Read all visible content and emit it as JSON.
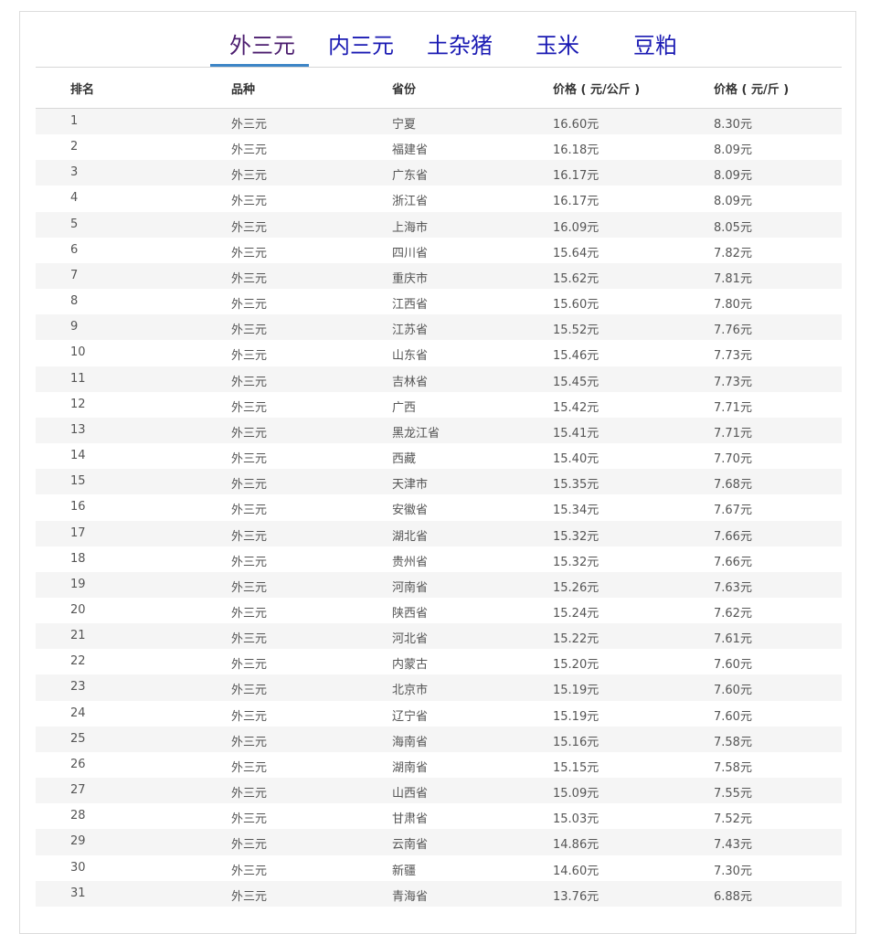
{
  "tabs": [
    {
      "label": "外三元",
      "active": true
    },
    {
      "label": "内三元",
      "active": false
    },
    {
      "label": "土杂猪",
      "active": false
    },
    {
      "label": "玉米",
      "active": false
    },
    {
      "label": "豆粕",
      "active": false
    }
  ],
  "table": {
    "headers": [
      "排名",
      "品种",
      "省份",
      "价格 ( 元/公斤 )",
      "价格 ( 元/斤 )"
    ],
    "rows": [
      [
        "1",
        "外三元",
        "宁夏",
        "16.60元",
        "8.30元"
      ],
      [
        "2",
        "外三元",
        "福建省",
        "16.18元",
        "8.09元"
      ],
      [
        "3",
        "外三元",
        "广东省",
        "16.17元",
        "8.09元"
      ],
      [
        "4",
        "外三元",
        "浙江省",
        "16.17元",
        "8.09元"
      ],
      [
        "5",
        "外三元",
        "上海市",
        "16.09元",
        "8.05元"
      ],
      [
        "6",
        "外三元",
        "四川省",
        "15.64元",
        "7.82元"
      ],
      [
        "7",
        "外三元",
        "重庆市",
        "15.62元",
        "7.81元"
      ],
      [
        "8",
        "外三元",
        "江西省",
        "15.60元",
        "7.80元"
      ],
      [
        "9",
        "外三元",
        "江苏省",
        "15.52元",
        "7.76元"
      ],
      [
        "10",
        "外三元",
        "山东省",
        "15.46元",
        "7.73元"
      ],
      [
        "11",
        "外三元",
        "吉林省",
        "15.45元",
        "7.73元"
      ],
      [
        "12",
        "外三元",
        "广西",
        "15.42元",
        "7.71元"
      ],
      [
        "13",
        "外三元",
        "黑龙江省",
        "15.41元",
        "7.71元"
      ],
      [
        "14",
        "外三元",
        "西藏",
        "15.40元",
        "7.70元"
      ],
      [
        "15",
        "外三元",
        "天津市",
        "15.35元",
        "7.68元"
      ],
      [
        "16",
        "外三元",
        "安徽省",
        "15.34元",
        "7.67元"
      ],
      [
        "17",
        "外三元",
        "湖北省",
        "15.32元",
        "7.66元"
      ],
      [
        "18",
        "外三元",
        "贵州省",
        "15.32元",
        "7.66元"
      ],
      [
        "19",
        "外三元",
        "河南省",
        "15.26元",
        "7.63元"
      ],
      [
        "20",
        "外三元",
        "陕西省",
        "15.24元",
        "7.62元"
      ],
      [
        "21",
        "外三元",
        "河北省",
        "15.22元",
        "7.61元"
      ],
      [
        "22",
        "外三元",
        "内蒙古",
        "15.20元",
        "7.60元"
      ],
      [
        "23",
        "外三元",
        "北京市",
        "15.19元",
        "7.60元"
      ],
      [
        "24",
        "外三元",
        "辽宁省",
        "15.19元",
        "7.60元"
      ],
      [
        "25",
        "外三元",
        "海南省",
        "15.16元",
        "7.58元"
      ],
      [
        "26",
        "外三元",
        "湖南省",
        "15.15元",
        "7.58元"
      ],
      [
        "27",
        "外三元",
        "山西省",
        "15.09元",
        "7.55元"
      ],
      [
        "28",
        "外三元",
        "甘肃省",
        "15.03元",
        "7.52元"
      ],
      [
        "29",
        "外三元",
        "云南省",
        "14.86元",
        "7.43元"
      ],
      [
        "30",
        "外三元",
        "新疆",
        "14.60元",
        "7.30元"
      ],
      [
        "31",
        "外三元",
        "青海省",
        "13.76元",
        "6.88元"
      ]
    ]
  },
  "colors": {
    "tab_text": "#1a1ab3",
    "tab_active_text": "#4b1c6e",
    "tab_underline": "#3d85c6",
    "row_stripe": "#f5f5f5",
    "header_text": "#333333",
    "cell_text": "#555555"
  }
}
